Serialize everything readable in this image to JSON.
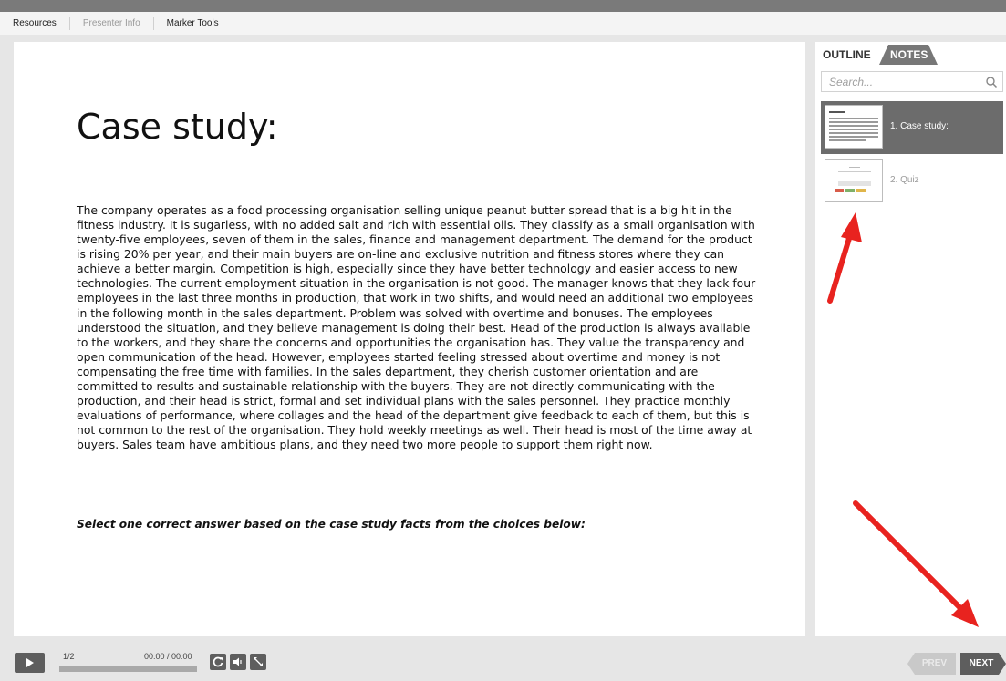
{
  "menu": {
    "resources": "Resources",
    "presenter_info": "Presenter Info",
    "marker_tools": "Marker Tools"
  },
  "slide": {
    "title": "Case study:",
    "body": "The company operates as a food processing organisation selling unique peanut butter spread that is a big hit in the fitness industry. It is sugarless, with no added salt and rich with essential oils. They classify as a small organisation with twenty-five employees, seven of them in the sales, finance and management department. The demand for the product is rising 20% per year, and their main buyers are on-line and exclusive nutrition and fitness stores where they can achieve a better margin. Competition is high, especially since they have better technology and easier access to new technologies. The current employment situation in the organisation is not good. The manager knows that they lack four employees in the last three months in production, that work in two shifts, and would need an additional two employees in the following month in the sales department. Problem was solved with overtime and bonuses. The employees understood the situation, and they believe management is doing their best. Head of the production is always available to the workers, and they share the concerns and opportunities the organisation has. They value the transparency and open communication of the head. However, employees started feeling stressed about overtime and money is not compensating the free time with families. In the sales department, they cherish customer orientation and are committed to results and sustainable relationship with the buyers. They are not directly communicating with the production, and their head is strict, formal and set individual plans with the sales personnel. They practice monthly evaluations of performance, where collages and the head of the department give feedback to each of them, but this is not common to the rest of the organisation. They hold weekly meetings as well. Their head is most of the time away at buyers. Sales team have ambitious plans, and they need two more people to support them right now.",
    "instruction": "Select one correct answer based on the case study facts from the choices below:"
  },
  "sidebar": {
    "tabs": [
      {
        "label": "OUTLINE",
        "active": true
      },
      {
        "label": "NOTES",
        "active": false
      }
    ],
    "search_placeholder": "Search...",
    "items": [
      {
        "label": "1. Case study:",
        "active": true
      },
      {
        "label": "2. Quiz",
        "active": false
      }
    ]
  },
  "player": {
    "counter": "1/2",
    "time": "00:00 / 00:00",
    "progress": 0,
    "prev_label": "PREV",
    "next_label": "NEXT",
    "icons": [
      "play-icon",
      "replay-icon",
      "volume-icon",
      "fullscreen-icon"
    ]
  },
  "colors": {
    "annotation_arrow": "#e8231f",
    "active_item_bg": "#6c6c6c",
    "control_bg": "#5e5e5e"
  }
}
